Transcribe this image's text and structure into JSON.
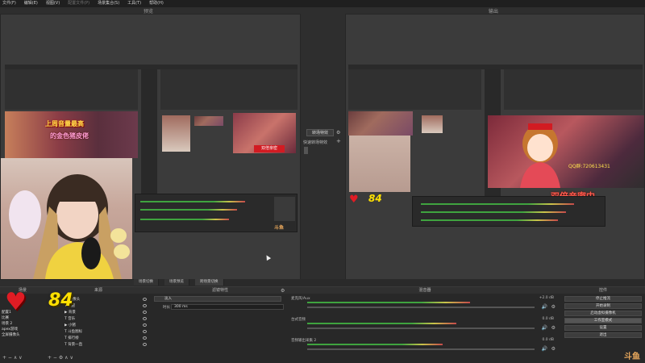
{
  "menu": {
    "items": [
      "文件(F)",
      "编辑(E)",
      "视图(V)",
      "配置文件(P)",
      "场景集合(S)",
      "工具(T)",
      "帮助(H)"
    ],
    "disabled_index": 3
  },
  "preview": {
    "title": "预览"
  },
  "program": {
    "title": "输出"
  },
  "transition": {
    "button_label": "转场特效",
    "quick_label": "快速转场特效",
    "gear": "gear-icon",
    "plus": "plus-icon"
  },
  "overlay": {
    "banner_left_1": "上周音量最高",
    "banner_left_2": "的金色猪皮佬",
    "badge_left": "双倍亲密",
    "double_intimacy": "双倍亲密中",
    "qq_group": "QQ群:720613431",
    "heart_number": "84",
    "watermark": "斗鱼",
    "mixer_watermark": "斗鱼"
  },
  "scene_tabs": [
    "场景切换",
    "场景预览",
    "跨场景切换"
  ],
  "docks": {
    "sources": {
      "title": "来源",
      "items": [
        {
          "icon": "camera-icon",
          "label": "摄像头"
        },
        {
          "icon": "text-icon",
          "label": "欢迎"
        },
        {
          "icon": "image-icon",
          "label": "背景"
        },
        {
          "icon": "text-icon",
          "label": "音乐"
        },
        {
          "icon": "image-icon",
          "label": "小猪"
        },
        {
          "icon": "text-icon",
          "label": "斗鱼图标"
        },
        {
          "icon": "text-icon",
          "label": "排行榜"
        },
        {
          "icon": "text-icon",
          "label": "背景一直"
        }
      ]
    },
    "scenes": {
      "title": "场景",
      "items": [
        "配置1",
        "比赛",
        "场景 2",
        "apex游戏",
        "全屏摄像头"
      ]
    },
    "filters": {
      "title": "滤镜特性",
      "row1_label": "淡入",
      "row2_label": "时长",
      "row2_value": "300 ms"
    },
    "mixer": {
      "title": "混音器",
      "tracks": [
        {
          "name": "麦克风/Aux",
          "db": "+2.0 dB",
          "level": 0.72
        },
        {
          "name": "台式音频",
          "db": "0.0 dB",
          "level": 0.66
        },
        {
          "name": "音频输出采集 2",
          "db": "0.0 dB",
          "level": 0.6
        }
      ]
    },
    "controls": {
      "title": "控件",
      "buttons": [
        "停止推流",
        "开始录制",
        "启动虚拟摄像机",
        "工作室模式",
        "设置",
        "退出"
      ],
      "selected_index": 3
    }
  },
  "colors": {
    "accent_red": "#ff5b4d",
    "meter_green": "#3fa33f",
    "yellow_text": "#ffe000"
  }
}
